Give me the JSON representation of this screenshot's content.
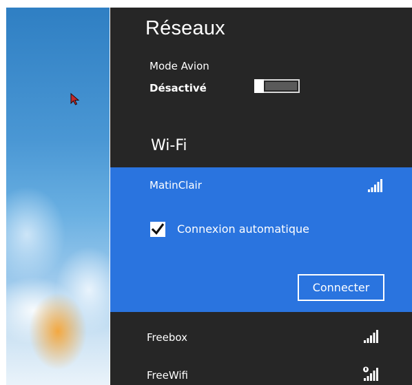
{
  "panel": {
    "title": "Réseaux",
    "airplane_mode": {
      "label": "Mode Avion",
      "state": "Désactivé",
      "on": false
    },
    "wifi_section_title": "Wi-Fi"
  },
  "networks": [
    {
      "name": "MatinClair",
      "selected": true,
      "signal_icon": "signal-strength-icon",
      "auto_connect_label": "Connexion automatique",
      "auto_connect": true,
      "connect_label": "Connecter"
    },
    {
      "name": "Freebox",
      "signal_icon": "signal-strength-icon"
    },
    {
      "name": "FreeWifi",
      "signal_icon": "unsecured-signal-icon"
    }
  ],
  "colors": {
    "panel_bg": "#262626",
    "selected_bg": "#2a74df",
    "text": "#ffffff"
  }
}
